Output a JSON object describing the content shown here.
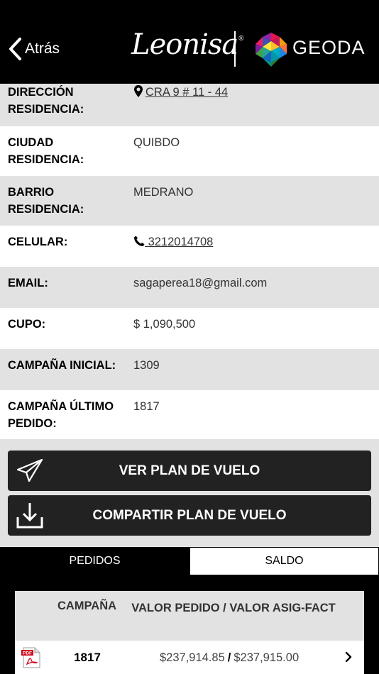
{
  "header": {
    "back_label": "Atrás",
    "brand_left": "Leonisa",
    "brand_left_mark": "®",
    "brand_right": "GEODA"
  },
  "info_rows": [
    {
      "label": "DIRECCIÓN RESIDENCIA:",
      "value": "CRA 9 # 11 - 44",
      "icon": "location-pin-icon"
    },
    {
      "label": "CIUDAD RESIDENCIA:",
      "value": "QUIBDO"
    },
    {
      "label": "BARRIO RESIDENCIA:",
      "value": "MEDRANO"
    },
    {
      "label": "CELULAR:",
      "value": " 3212014708",
      "icon": "phone-icon"
    },
    {
      "label": "EMAIL:",
      "value": "sagaperea18@gmail.com"
    },
    {
      "label": "CUPO:",
      "value": "$ 1,090,500"
    },
    {
      "label": "CAMPAÑA INICIAL:",
      "value": "1309"
    },
    {
      "label": "CAMPAÑA ÚLTIMO PEDIDO:",
      "value": "1817"
    }
  ],
  "buttons": {
    "view_plan": "VER PLAN DE VUELO",
    "share_plan": "COMPARTIR PLAN DE VUELO"
  },
  "tabs": [
    {
      "label": "PEDIDOS",
      "active": false
    },
    {
      "label": "SALDO",
      "active": true
    }
  ],
  "table": {
    "headers": [
      "CAMPAÑA",
      "VALOR PEDIDO / VALOR ASIG-FACT"
    ],
    "rows": [
      {
        "campaign": "1817",
        "order_value": "$237,914.85",
        "separator": "/",
        "assigned_value": "$237,915.00"
      }
    ]
  },
  "colors": {
    "header_bg": "#000000",
    "row_gray": "#e2e2e2",
    "row_white": "#ffffff",
    "button_bg": "#222222",
    "pdf_red": "#d0021b"
  }
}
